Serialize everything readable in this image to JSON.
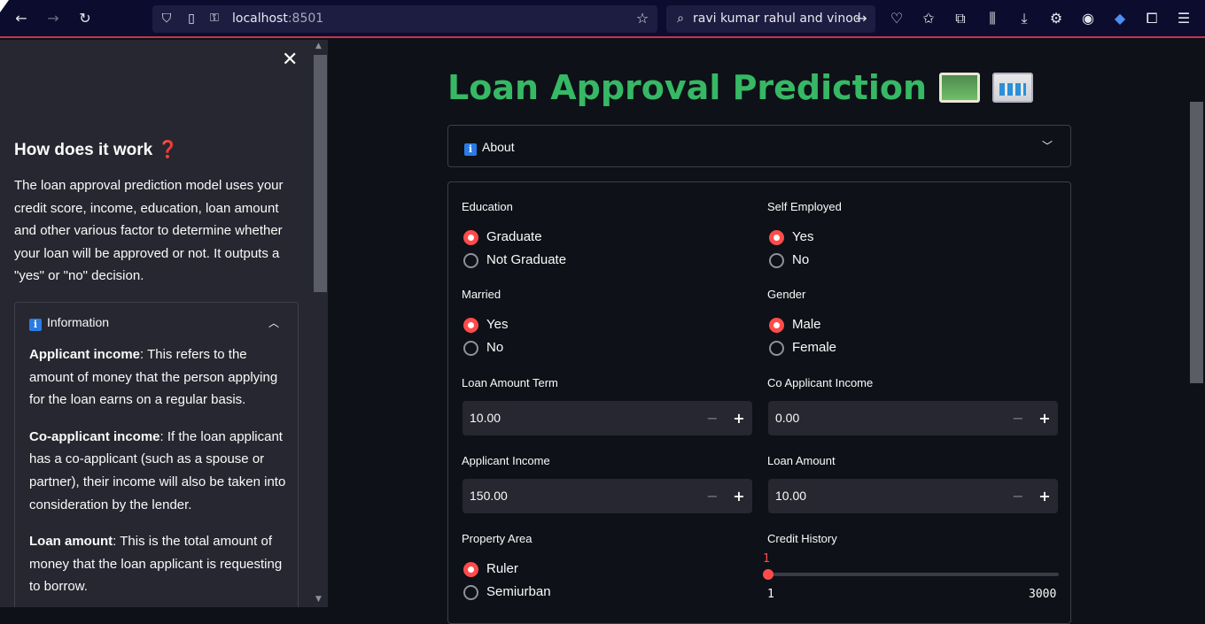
{
  "browser": {
    "url_host": "localhost",
    "url_port": ":8501",
    "search_text": "ravi kumar rahul and vinod"
  },
  "sidebar": {
    "close_glyph": "✕",
    "title": "How does it work ❓",
    "description": "The loan approval prediction model uses your credit score, income, education, loan amount and other various factor to determine whether your loan will be approved or not. It outputs a \"yes\" or \"no\" decision.",
    "info_expander": {
      "badge": "i",
      "label": "Information",
      "items": [
        {
          "term": "Applicant income",
          "text": ": This refers to the amount of money that the person applying for the loan earns on a regular basis."
        },
        {
          "term": "Co-applicant income",
          "text": ": If the loan applicant has a co-applicant (such as a spouse or partner), their income will also be taken into consideration by the lender."
        },
        {
          "term": "Loan amount",
          "text": ": This is the total amount of money that the loan applicant is requesting to borrow."
        }
      ]
    }
  },
  "main": {
    "title": "Loan Approval Prediction",
    "about_badge": "i",
    "about_label": "About",
    "education": {
      "label": "Education",
      "options": [
        "Graduate",
        "Not Graduate"
      ],
      "selected": 0
    },
    "self_employed": {
      "label": "Self Employed",
      "options": [
        "Yes",
        "No"
      ],
      "selected": 0
    },
    "married": {
      "label": "Married",
      "options": [
        "Yes",
        "No"
      ],
      "selected": 0
    },
    "gender": {
      "label": "Gender",
      "options": [
        "Male",
        "Female"
      ],
      "selected": 0
    },
    "loan_amount_term": {
      "label": "Loan Amount Term",
      "value": "10.00"
    },
    "co_applicant_income": {
      "label": "Co Applicant Income",
      "value": "0.00"
    },
    "applicant_income": {
      "label": "Applicant Income",
      "value": "150.00"
    },
    "loan_amount": {
      "label": "Loan Amount",
      "value": "10.00"
    },
    "property_area": {
      "label": "Property Area",
      "options": [
        "Ruler",
        "Semiurban"
      ],
      "selected": 0
    },
    "credit_history": {
      "label": "Credit History",
      "value": "1",
      "min": "1",
      "max": "3000"
    },
    "stepper": {
      "minus": "−",
      "plus": "+"
    }
  },
  "colors": {
    "accent": "#ff4b4b",
    "title_green": "#36b865",
    "bg": "#0e1117",
    "sidebar_bg": "#262730"
  }
}
